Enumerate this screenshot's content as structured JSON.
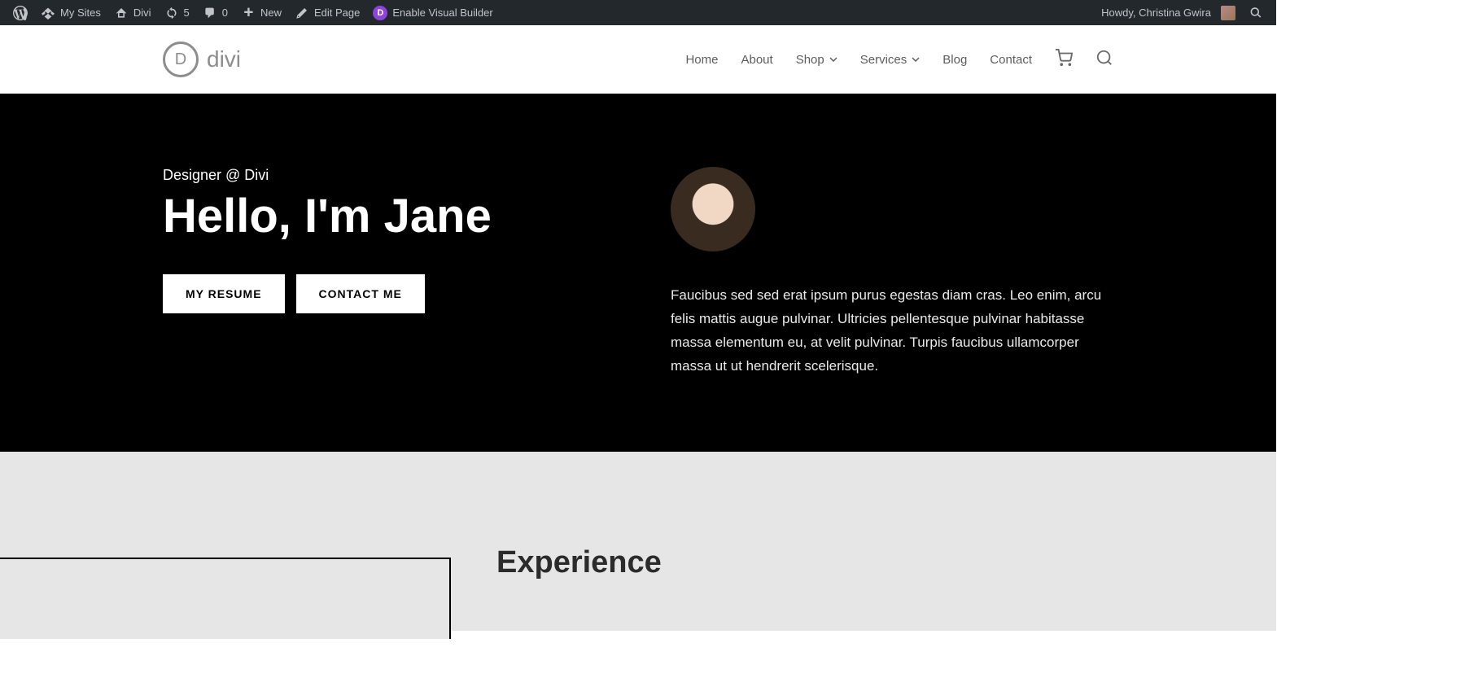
{
  "adminBar": {
    "mySites": "My Sites",
    "siteName": "Divi",
    "updates": "5",
    "comments": "0",
    "newLabel": "New",
    "editPage": "Edit Page",
    "enableVB": "Enable Visual Builder",
    "howdy": "Howdy, Christina Gwira"
  },
  "nav": {
    "logoText": "divi",
    "home": "Home",
    "about": "About",
    "shop": "Shop",
    "services": "Services",
    "blog": "Blog",
    "contact": "Contact"
  },
  "hero": {
    "subtitle": "Designer @ Divi",
    "title": "Hello, I'm Jane",
    "resumeBtn": "MY RESUME",
    "contactBtn": "CONTACT ME",
    "bio": "Faucibus sed sed erat ipsum purus egestas diam cras. Leo enim, arcu felis mattis augue pulvinar. Ultricies pellentesque pulvinar habitasse massa elementum eu, at velit pulvinar. Turpis faucibus ullamcorper massa ut ut hendrerit scelerisque."
  },
  "experience": {
    "title": "Experience"
  }
}
